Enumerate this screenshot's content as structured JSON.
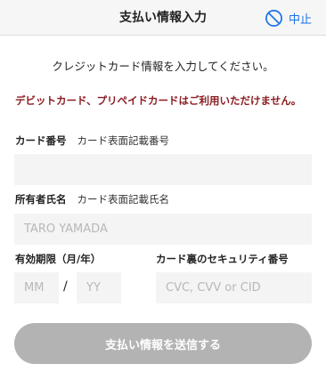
{
  "header": {
    "title": "支払い情報入力",
    "cancel_label": "中止"
  },
  "instruction": "クレジットカード情報を入力してください。",
  "notice": "デビットカード、プリペイドカードはご利用いただけません。",
  "card_number": {
    "label": "カード番号",
    "hint": "カード表面記載番号",
    "value": "",
    "placeholder": ""
  },
  "holder_name": {
    "label": "所有者氏名",
    "hint": "カード表面記載氏名",
    "value": "",
    "placeholder": "TARO YAMADA"
  },
  "expiry": {
    "label": "有効期限（月/年）",
    "month_placeholder": "MM",
    "separator": "/",
    "year_placeholder": "YY"
  },
  "security_code": {
    "label": "カード裏のセキュリティ番号",
    "placeholder": "CVC, CVV or CID"
  },
  "submit_label": "支払い情報を送信する",
  "colors": {
    "accent": "#1a73e8",
    "notice": "#8b1c22",
    "disabled_button": "#b3b3b3",
    "field_background": "#f4f4f4"
  },
  "icons": {
    "cancel": "prohibited-circle-icon"
  }
}
